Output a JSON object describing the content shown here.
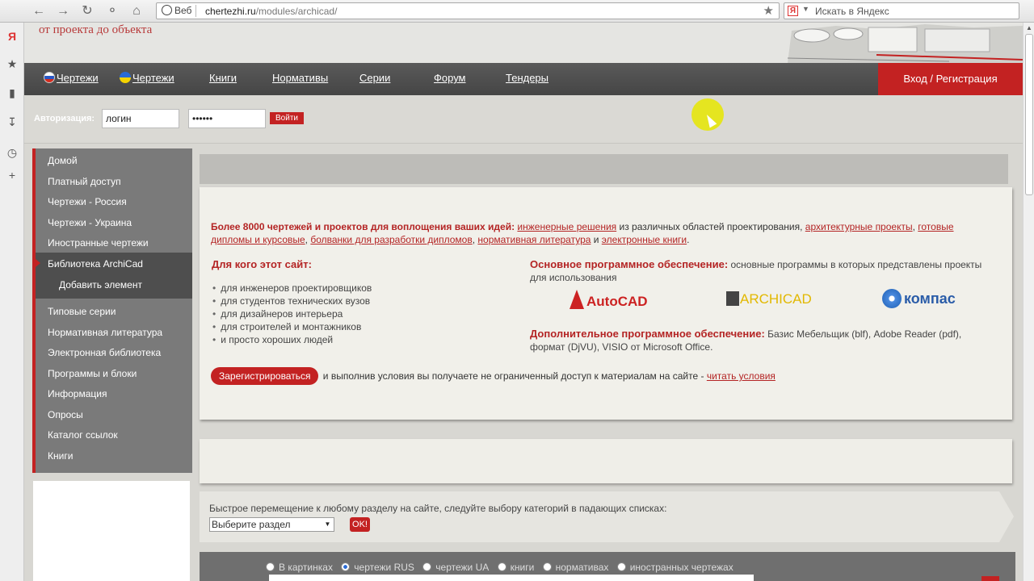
{
  "browser": {
    "web_label": "Веб",
    "url_domain": "chertezhi.ru",
    "url_path": "/modules/archicad/",
    "search_placeholder": "Искать в Яндекс",
    "yandex_badge": "Я"
  },
  "site": {
    "slogan": "от проекта до объекта",
    "nav": [
      {
        "label": "Чертежи",
        "flag": "ru"
      },
      {
        "label": "Чертежи",
        "flag": "ua"
      },
      {
        "label": "Книги"
      },
      {
        "label": "Нормативы"
      },
      {
        "label": "Серии"
      },
      {
        "label": "Форум"
      },
      {
        "label": "Тендеры"
      }
    ],
    "login_label": "Вход / Регистрация",
    "auth": {
      "label": "Авторизация:",
      "login_value": "логин",
      "password_value": "••••••",
      "submit": "Войти"
    }
  },
  "menu": {
    "items": [
      "Домой",
      "Платный доступ",
      "Чертежи - Россия",
      "Чертежи - Украина",
      "Иностранные чертежи",
      "Библиотека ArchiCad",
      "Добавить элемент",
      "Типовые серии",
      "Нормативная литература",
      "Электронная библиотека",
      "Программы и блоки",
      "Информация",
      "Опросы",
      "Каталог ссылок",
      "Книги"
    ],
    "active": "Библиотека ArchiCad"
  },
  "info": {
    "intro_bold": "Более 8000 чертежей и проектов для воплощения ваших идей:",
    "intro_link1": "инженерные решения",
    "intro_text1": " из различных областей проектирования, ",
    "intro_link2": "архитектурные проекты",
    "intro_sep1": ", ",
    "intro_link3": "готовые дипломы и курсовые",
    "intro_sep2": ", ",
    "intro_link4": "болванки для разработки дипломов",
    "intro_sep3": ", ",
    "intro_link5": "нормативная литература",
    "intro_and": " и ",
    "intro_link6": "электронные книги",
    "intro_end": ".",
    "who_title": "Для кого этот сайт:",
    "who_list": [
      "для инженеров проектировщиков",
      "для студентов технических вузов",
      "для дизайнеров интерьера",
      "для строителей и монтажников",
      "и просто хороших людей"
    ],
    "main_sw_title": "Основное программное обеспечение:",
    "main_sw_text": " основные программы в которых представлены проекты для использования",
    "logos": [
      "AutoCAD",
      "ARCHICAD",
      "компас"
    ],
    "extra_sw_title": "Дополнительное программное обеспечение:",
    "extra_sw_text": " Базис Мебельщик (blf), Adobe Reader (pdf), формат (DjVU), VISIO от Microsoft Office.",
    "register_button": "Зарегистрироваться",
    "register_text": " и выполнив условия вы получаете не ограниченный доступ к материалам на сайте - ",
    "register_link": "читать условия"
  },
  "quick": {
    "text": "Быстрое перемещение к любому разделу на сайте, следуйте выбору категорий в падающих списках:",
    "select_value": "Выберите раздел",
    "ok": "OK!"
  },
  "search": {
    "options": [
      "В картинках",
      "чертежи RUS",
      "чертежи UA",
      "книги",
      "нормативах",
      "иностранных чертежах"
    ],
    "selected": "чертежи RUS"
  },
  "colors": {
    "accent": "#c32222",
    "nav_bg": "#4f4f4f",
    "menu_bg": "#7a7a7a",
    "content_bg": "#f1f0ea"
  }
}
